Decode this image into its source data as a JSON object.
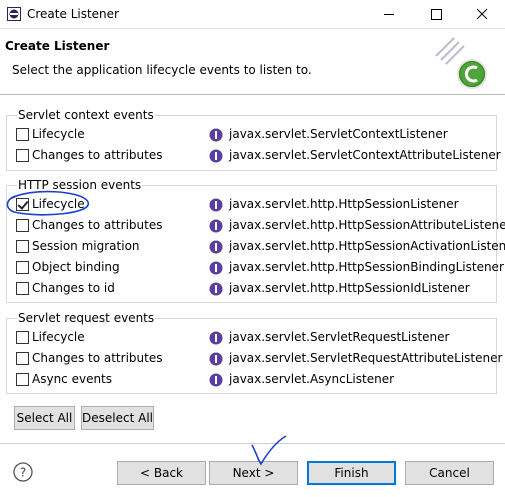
{
  "window": {
    "title": "Create Listener"
  },
  "banner": {
    "title": "Create Listener",
    "description": "Select the application lifecycle events to listen to."
  },
  "groups": [
    {
      "label": "Servlet context events",
      "items": [
        {
          "label": "Lifecycle",
          "interface": "javax.servlet.ServletContextListener",
          "checked": false
        },
        {
          "label": "Changes to attributes",
          "interface": "javax.servlet.ServletContextAttributeListener",
          "checked": false
        }
      ]
    },
    {
      "label": "HTTP session events",
      "items": [
        {
          "label": "Lifecycle",
          "interface": "javax.servlet.http.HttpSessionListener",
          "checked": true
        },
        {
          "label": "Changes to attributes",
          "interface": "javax.servlet.http.HttpSessionAttributeListener",
          "checked": false
        },
        {
          "label": "Session migration",
          "interface": "javax.servlet.http.HttpSessionActivationListener",
          "checked": false
        },
        {
          "label": "Object binding",
          "interface": "javax.servlet.http.HttpSessionBindingListener",
          "checked": false
        },
        {
          "label": "Changes to id",
          "interface": "javax.servlet.http.HttpSessionIdListener",
          "checked": false
        }
      ]
    },
    {
      "label": "Servlet request events",
      "items": [
        {
          "label": "Lifecycle",
          "interface": "javax.servlet.ServletRequestListener",
          "checked": false
        },
        {
          "label": "Changes to attributes",
          "interface": "javax.servlet.ServletRequestAttributeListener",
          "checked": false
        },
        {
          "label": "Async events",
          "interface": "javax.servlet.AsyncListener",
          "checked": false
        }
      ]
    }
  ],
  "selection": {
    "select_all": "Select All",
    "deselect_all": "Deselect All"
  },
  "footer": {
    "back": "< Back",
    "next": "Next >",
    "finish": "Finish",
    "cancel": "Cancel"
  },
  "colors": {
    "interface_icon": "#5b3f9e",
    "annotation": "#1f3fc8",
    "primary_border": "#0078d7"
  }
}
